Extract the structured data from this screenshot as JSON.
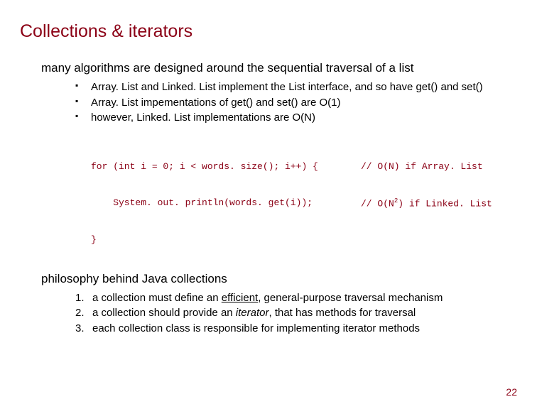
{
  "title": "Collections & iterators",
  "intro": "many algorithms are designed around the sequential traversal of a list",
  "bullets": [
    "Array. List and Linked. List implement the List interface, and so have get() and set()",
    "Array. List impementations of get() and set() are O(1)",
    "however, Linked. List implementations are O(N)"
  ],
  "code": {
    "l1": "for (int i = 0; i < words. size(); i++) {",
    "l2": "    System. out. println(words. get(i));",
    "l3": "}",
    "c1": "// O(N) if Array. List",
    "c2a": "// O(N",
    "c2b": ") if Linked. List",
    "sup": "2"
  },
  "subhead": "philosophy behind Java collections",
  "numitems": [
    {
      "pre": "a collection must define an ",
      "u": "efficient",
      "post": ", general-purpose traversal mechanism"
    },
    {
      "pre": "a collection should provide an ",
      "i": "iterator",
      "post": ", that has methods for traversal"
    },
    {
      "pre": "each collection class is responsible for implementing iterator methods",
      "u": "",
      "i": "",
      "post": ""
    }
  ],
  "pagenum": "22"
}
